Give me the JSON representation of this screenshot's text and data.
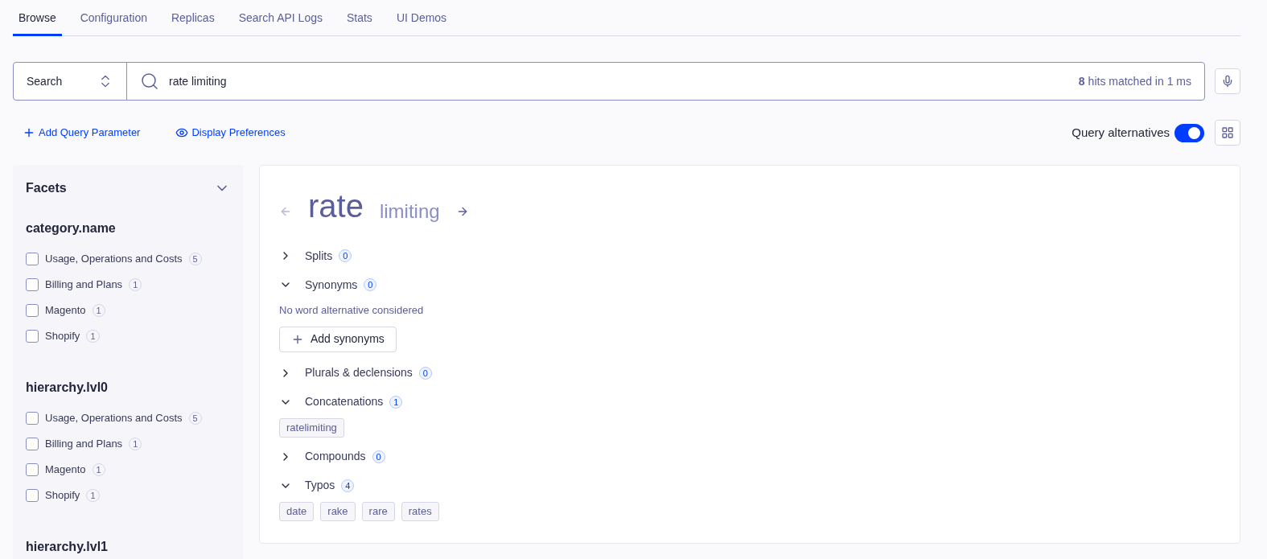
{
  "tabs": [
    {
      "label": "Browse",
      "selected": true
    },
    {
      "label": "Configuration",
      "selected": false
    },
    {
      "label": "Replicas",
      "selected": false
    },
    {
      "label": "Search API Logs",
      "selected": false
    },
    {
      "label": "Stats",
      "selected": false
    },
    {
      "label": "UI Demos",
      "selected": false
    }
  ],
  "search": {
    "mode": "Search",
    "value": "rate limiting",
    "hits_count": "8",
    "hits_text": "hits matched in 1 ms"
  },
  "actions": [
    "Add Query Parameter",
    "Display Preferences"
  ],
  "query_alternatives": {
    "label": "Query alternatives",
    "on": true
  },
  "facets": {
    "title": "Facets",
    "expanded": true,
    "groups": [
      {
        "name": "category.name",
        "items": [
          {
            "label": "Usage, Operations and Costs",
            "count": "5",
            "checked": false
          },
          {
            "label": "Billing and Plans",
            "count": "1",
            "checked": false
          },
          {
            "label": "Magento",
            "count": "1",
            "checked": false
          },
          {
            "label": "Shopify",
            "count": "1",
            "checked": false
          }
        ]
      },
      {
        "name": "hierarchy.lvl0",
        "items": [
          {
            "label": "Usage, Operations and Costs",
            "count": "5",
            "checked": false
          },
          {
            "label": "Billing and Plans",
            "count": "1",
            "checked": false
          },
          {
            "label": "Magento",
            "count": "1",
            "checked": false
          },
          {
            "label": "Shopify",
            "count": "1",
            "checked": false
          }
        ]
      },
      {
        "name": "hierarchy.lvl1"
      }
    ]
  },
  "query_words": [
    {
      "text": "rate",
      "selected": true
    },
    {
      "text": "limiting",
      "selected": false
    }
  ],
  "sections": [
    {
      "label": "Splits",
      "count": "0",
      "expanded": false
    },
    {
      "label": "Synonyms",
      "count": "0",
      "expanded": true,
      "message": "No word alternative considered",
      "button": "Add synonyms"
    },
    {
      "label": "Plurals & declensions",
      "count": "0",
      "expanded": false
    },
    {
      "label": "Concatenations",
      "count": "1",
      "expanded": true,
      "tags": [
        "ratelimiting"
      ]
    },
    {
      "label": "Compounds",
      "count": "0",
      "expanded": false
    },
    {
      "label": "Typos",
      "count": "4",
      "expanded": true,
      "tags": [
        "date",
        "rake",
        "rare",
        "rates"
      ]
    }
  ]
}
